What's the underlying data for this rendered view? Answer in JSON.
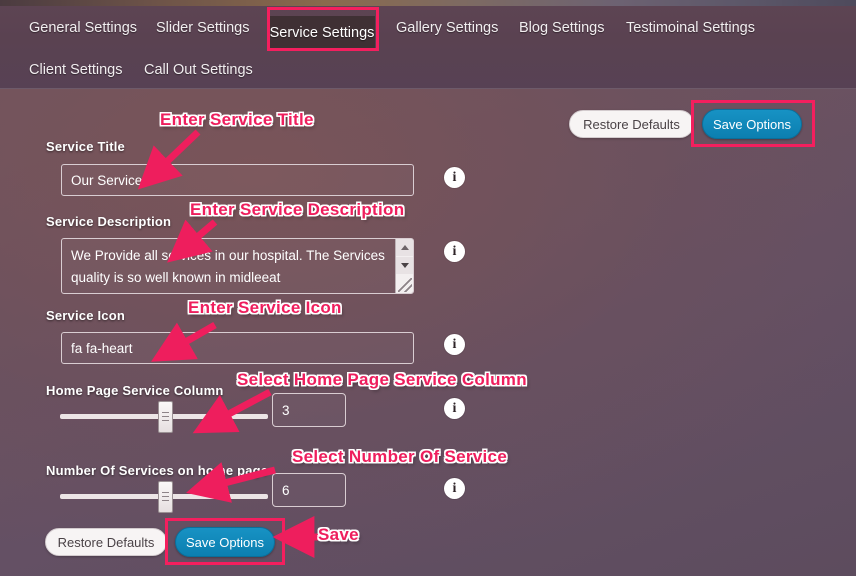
{
  "window": {
    "accent_pink": "#f41f5e",
    "accent_blue": "#0c7fb0",
    "background_top": "#7a5b5f",
    "background_bottom": "#5d4c5e"
  },
  "header": {
    "tabs_row1": [
      {
        "label": "General Settings",
        "active": false
      },
      {
        "label": "Slider Settings",
        "active": false
      },
      {
        "label": "Service Settings",
        "active": true
      },
      {
        "label": "Gallery Settings",
        "active": false
      },
      {
        "label": "Blog Settings",
        "active": false
      },
      {
        "label": "Testimoinal Settings",
        "active": false
      }
    ],
    "tabs_row2": [
      {
        "label": "Client Settings",
        "active": false
      },
      {
        "label": "Call Out Settings",
        "active": false
      }
    ]
  },
  "toolbar_top": {
    "restore_label": "Restore Defaults",
    "save_label": "Save Options"
  },
  "toolbar_bottom": {
    "restore_label": "Restore Defaults",
    "save_label": "Save Options"
  },
  "form": {
    "service_title": {
      "label": "Service Title",
      "value": "Our Services",
      "info": "i"
    },
    "service_description": {
      "label": "Service Description",
      "value": "We Provide all services in our hospital. The Services quality is so well known in midleeat",
      "info": "i"
    },
    "service_icon": {
      "label": "Service Icon",
      "value": "fa fa-heart",
      "info": "i"
    },
    "home_page_service_column": {
      "label": "Home Page Service Column",
      "value": "3",
      "info": "i",
      "slider_percent": 50
    },
    "number_of_services": {
      "label": "Number Of Services on home page",
      "value": "6",
      "info": "i",
      "slider_percent": 50
    }
  },
  "annotations": [
    {
      "text": "Enter Service Title"
    },
    {
      "text": "Enter Service Description"
    },
    {
      "text": "Enter Service Icon"
    },
    {
      "text": "Select Home Page Service Column"
    },
    {
      "text": "Select Number Of Service"
    },
    {
      "text": "Save"
    }
  ]
}
